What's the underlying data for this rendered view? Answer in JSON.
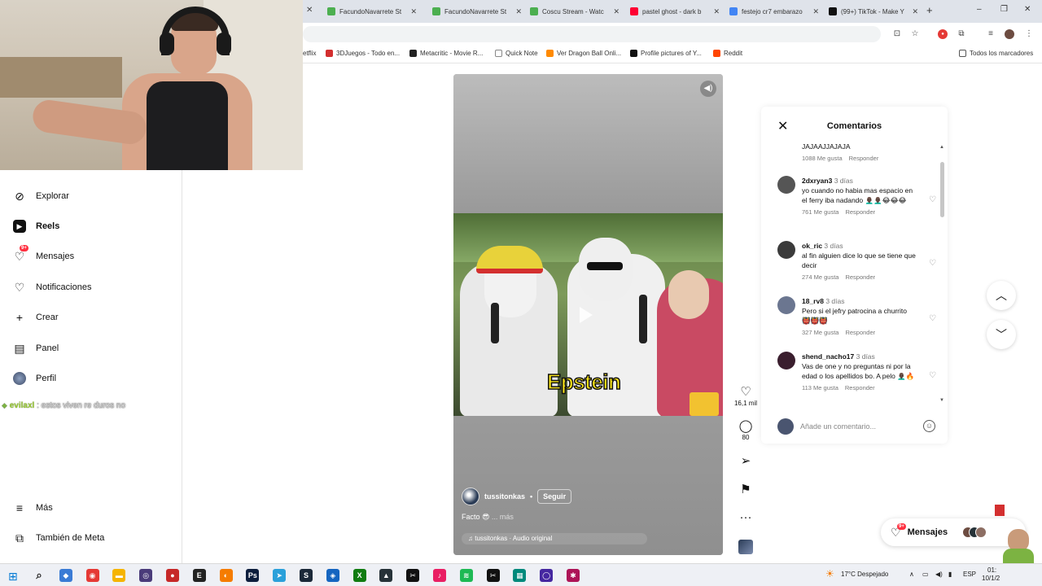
{
  "browser": {
    "tabs": [
      {
        "label": "FacundoNavarrete St",
        "color": "#4caf50"
      },
      {
        "label": "FacundoNavarrete St",
        "color": "#4caf50"
      },
      {
        "label": "Coscu Stream - Watc",
        "color": "#4caf50"
      },
      {
        "label": "pastel ghost - dark b",
        "color": "#ff0033"
      },
      {
        "label": "festejo cr7 embarazo",
        "color": "#4285f4"
      },
      {
        "label": "(99+) TikTok - Make Y",
        "color": "#111111"
      }
    ],
    "new_tab": "+",
    "window_controls": {
      "minimize": "–",
      "maximize": "❐",
      "close": "✕"
    }
  },
  "bookmarks": [
    {
      "label": "etflix",
      "color": "#e50914"
    },
    {
      "label": "3DJuegos - Todo en...",
      "color": "#d32f2f"
    },
    {
      "label": "Metacritic - Movie R...",
      "color": "#222222"
    },
    {
      "label": "Quick Note",
      "color": "#ffffff"
    },
    {
      "label": "Ver Dragon Ball Onli...",
      "color": "#ff8a00"
    },
    {
      "label": "Profile pictures of Y...",
      "color": "#111111"
    },
    {
      "label": "Reddit",
      "color": "#ff4500"
    },
    {
      "label": "Todos los marcadores",
      "color": "#555555"
    }
  ],
  "sidebar": {
    "items": [
      {
        "label": "Explorar",
        "icon": "compass-icon",
        "glyph": "⊘"
      },
      {
        "label": "Reels",
        "icon": "reels-icon",
        "glyph": "▣"
      },
      {
        "label": "Mensajes",
        "icon": "messenger-icon",
        "glyph": "♡",
        "badge": "9+"
      },
      {
        "label": "Notificaciones",
        "icon": "heart-icon",
        "glyph": "♡"
      },
      {
        "label": "Crear",
        "icon": "plus-icon",
        "glyph": "+"
      },
      {
        "label": "Panel",
        "icon": "dashboard-icon",
        "glyph": "▤"
      },
      {
        "label": "Perfil",
        "icon": "profile-avatar",
        "glyph": "●"
      }
    ],
    "bottom": [
      {
        "label": "Más",
        "icon": "menu-icon",
        "glyph": "≡"
      },
      {
        "label": "También de Meta",
        "icon": "meta-icon",
        "glyph": "⧉"
      }
    ]
  },
  "stream_chat": {
    "user": "evilaxl",
    "message": " : estos viven re duros no"
  },
  "reel": {
    "caption_word": "Epstein",
    "username": "tussitonkas",
    "separator": "•",
    "follow_label": "Seguir",
    "caption": "Facto 😎",
    "more": " ... más",
    "audio": "♫ tussitonkas · Audio original"
  },
  "actions": {
    "likes": "16,1 mil",
    "comments": "80"
  },
  "comments": {
    "title": "Comentarios",
    "items": [
      {
        "user": "",
        "time": "",
        "text": "JAJAAJJAJAJA",
        "likes": "1088 Me gusta",
        "reply": "Responder",
        "avatar": "#cccccc"
      },
      {
        "user": "2dxryan3",
        "time": "3 días",
        "text": "yo cuando no habia mas espacio en el ferry iba nadando 👨🏿‍🦲👨🏿‍🦲😂😂😂",
        "likes": "761 Me gusta",
        "reply": "Responder",
        "avatar": "#555555"
      },
      {
        "user": "ok_ric",
        "time": "3 días",
        "text": "al fin alguien dice lo que se tiene que decir",
        "likes": "274 Me gusta",
        "reply": "Responder",
        "avatar": "#3b3b3b"
      },
      {
        "user": "18_rv8",
        "time": "3 días",
        "text": "Pero si el jefry patrocina a churrito 👹👹👹",
        "likes": "327 Me gusta",
        "reply": "Responder",
        "avatar": "#6b7690"
      },
      {
        "user": "shend_nacho17",
        "time": "3 días",
        "text": "Vas de one y no preguntas ni por la edad o los apellidos bo. A pelo 👨🏿‍🦲🔥",
        "likes": "113 Me gusta",
        "reply": "Responder",
        "avatar": "#3a1e2e"
      }
    ],
    "input_placeholder": "Añade un comentario..."
  },
  "messages_pill": {
    "label": "Mensajes",
    "badge": "9+"
  },
  "taskbar": {
    "weather": "17°C Despejado",
    "lang": "ESP",
    "clock_time": "01:",
    "clock_date": "10/1/2",
    "icons": [
      {
        "name": "search-icon",
        "color": "#333333",
        "glyph": "⌕"
      },
      {
        "name": "copilot-icon",
        "color": "#3a7bd5",
        "glyph": "◆"
      },
      {
        "name": "chrome-icon",
        "color": "#e53935",
        "glyph": "◉"
      },
      {
        "name": "files-icon",
        "color": "#f5b400",
        "glyph": "▬"
      },
      {
        "name": "obs-icon",
        "color": "#4a3b7a",
        "glyph": "◎"
      },
      {
        "name": "app-red-icon",
        "color": "#c62828",
        "glyph": "●"
      },
      {
        "name": "epic-icon",
        "color": "#222222",
        "glyph": "E"
      },
      {
        "name": "orange-app-icon",
        "color": "#f57c00",
        "glyph": "◐"
      },
      {
        "name": "photoshop-icon",
        "color": "#0d1e3d",
        "glyph": "Ps"
      },
      {
        "name": "telegram-icon",
        "color": "#2aa0da",
        "glyph": "➤"
      },
      {
        "name": "steam-icon",
        "color": "#1b2838",
        "glyph": "S"
      },
      {
        "name": "blue-app-icon",
        "color": "#1565c0",
        "glyph": "◈"
      },
      {
        "name": "xbox-icon",
        "color": "#107c10",
        "glyph": "X"
      },
      {
        "name": "app-icon",
        "color": "#263238",
        "glyph": "▲"
      },
      {
        "name": "capcut-icon",
        "color": "#111111",
        "glyph": "✂"
      },
      {
        "name": "tiktok-icon",
        "color": "#e91e63",
        "glyph": "♪"
      },
      {
        "name": "spotify-icon",
        "color": "#1db954",
        "glyph": "≋"
      },
      {
        "name": "capcut2-icon",
        "color": "#111111",
        "glyph": "✂"
      },
      {
        "name": "notepad-icon",
        "color": "#00897b",
        "glyph": "▦"
      },
      {
        "name": "app-purple-icon",
        "color": "#4527a0",
        "glyph": "◯"
      },
      {
        "name": "app-pink-icon",
        "color": "#ad1457",
        "glyph": "✱"
      }
    ]
  }
}
